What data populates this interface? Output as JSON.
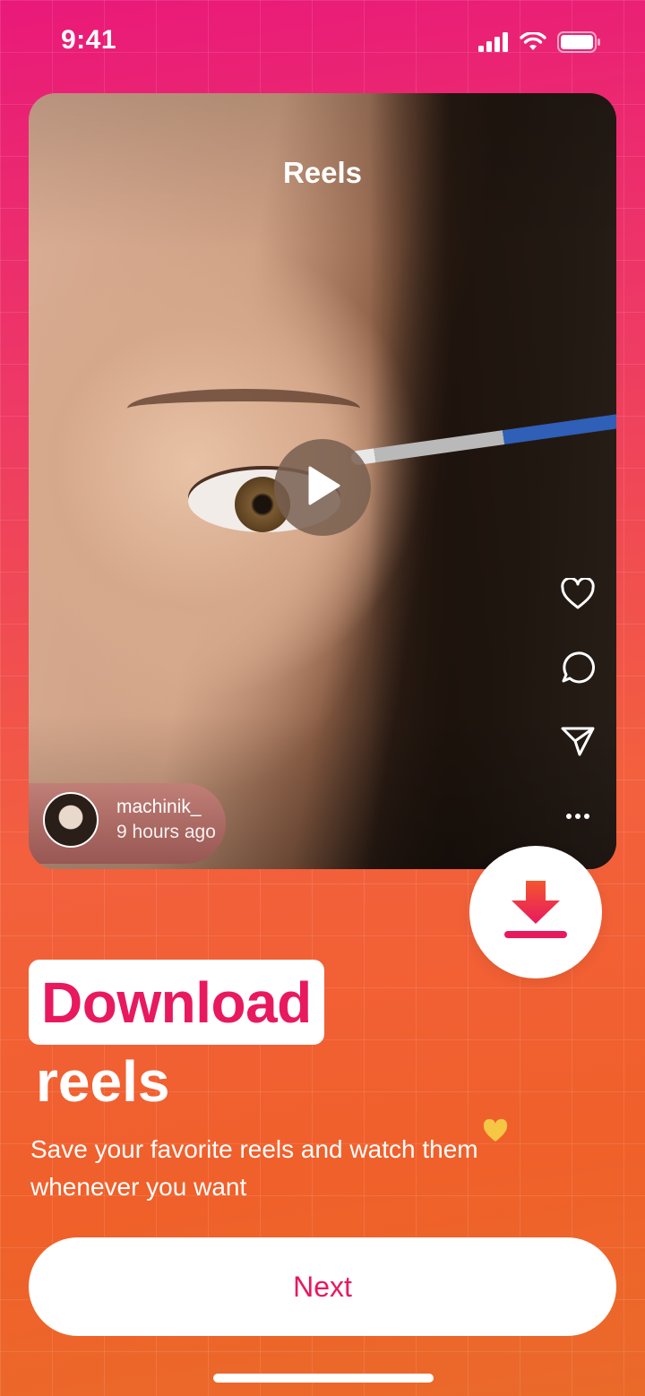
{
  "status_bar": {
    "time": "9:41",
    "signal_icon": "cellular-signal-icon",
    "wifi_icon": "wifi-icon",
    "battery_icon": "battery-icon"
  },
  "reel": {
    "title": "Reels",
    "author_name": "machinik_",
    "author_time": "9 hours ago",
    "play_icon": "play-icon",
    "actions": [
      "heart-icon",
      "comment-icon",
      "share-icon",
      "more-icon"
    ]
  },
  "download_icon": "download-icon",
  "headline": {
    "highlight": "Download",
    "second": "reels"
  },
  "subtitle": "Save your favorite reels and watch them whenever you want",
  "next_label": "Next",
  "colors": {
    "accent": "#e8195f",
    "gradient_top": "#e9197a",
    "gradient_bottom": "#f0602a",
    "heart": "#f6c744"
  }
}
